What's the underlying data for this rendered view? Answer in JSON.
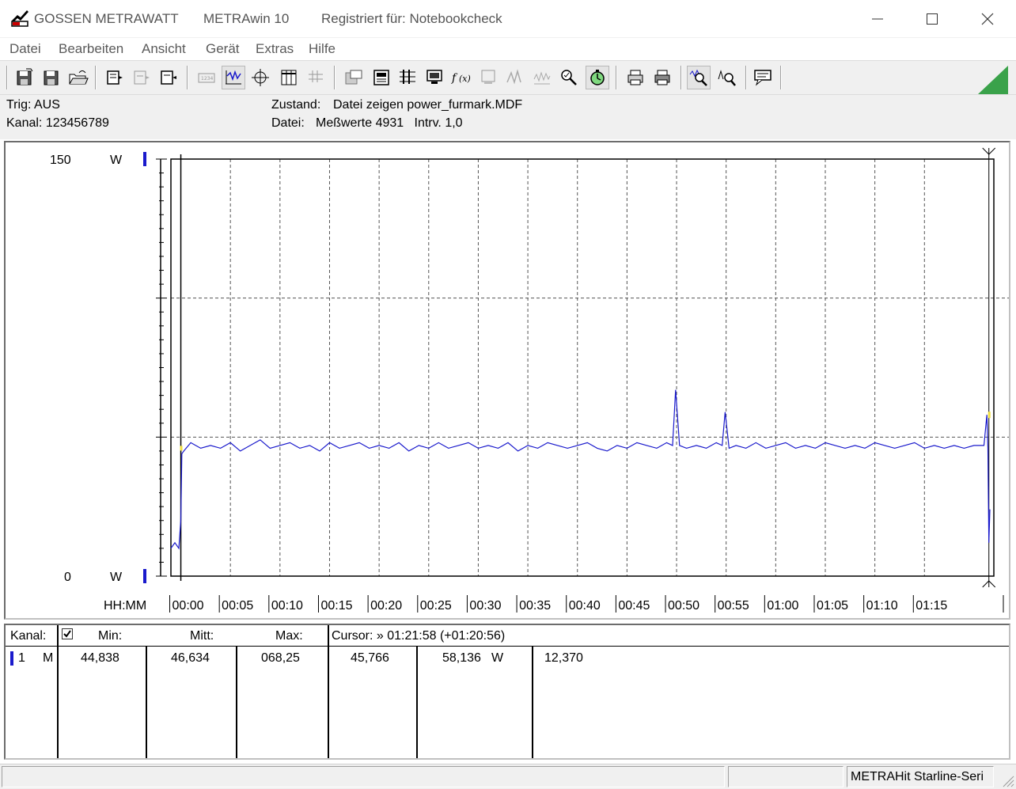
{
  "window": {
    "app_name": "GOSSEN METRAWATT",
    "version": "METRAwin 10",
    "registration": "Registriert für: Notebookcheck"
  },
  "menu": [
    "Datei",
    "Bearbeiten",
    "Ansicht",
    "Gerät",
    "Extras",
    "Hilfe"
  ],
  "toolbar": {
    "icons": [
      "save-icon",
      "save-as-icon",
      "open-icon",
      "export-icon",
      "disabled-export-icon",
      "import-icon",
      "memory-icon",
      "trace-view-icon",
      "crosshair-icon",
      "table-view-icon",
      "list-view-icon",
      "window-icon",
      "device-icon",
      "settings-icon",
      "monitor-icon",
      "function-icon",
      "device-disabled-icon",
      "signal-disabled-icon",
      "signal-disabled-2-icon",
      "zoom-check-icon",
      "timer-icon",
      "print-preview-icon",
      "print-icon",
      "zoom-icon",
      "zoom-out-icon",
      "comment-icon"
    ]
  },
  "info": {
    "trig": "Trig: AUS",
    "kanal": "Kanal: 123456789",
    "zustand_label": "Zustand:",
    "zustand_value": "Datei zeigen power_furmark.MDF",
    "datei_label": "Datei:",
    "datei_value": "Meßwerte 4931   Intrv. 1,0"
  },
  "chart_data": {
    "type": "line",
    "y_top_label": "150",
    "y_bottom_label": "0",
    "y_unit": "W",
    "ylim": [
      0,
      150
    ],
    "x_axis_label": "HH:MM",
    "x_ticks": [
      "00:00",
      "00:05",
      "00:10",
      "00:15",
      "00:20",
      "00:25",
      "00:30",
      "00:35",
      "00:40",
      "00:45",
      "00:50",
      "00:55",
      "01:00",
      "01:05",
      "01:10",
      "01:15"
    ],
    "x_range_minutes": [
      -1,
      82
    ],
    "grid": true,
    "series_color": "#1a1acc",
    "series": [
      {
        "name": "1",
        "x_minutes": [
          -1.0,
          -0.6,
          -0.2,
          0.0,
          0.1,
          0.3,
          1.0,
          2.0,
          3.0,
          4.0,
          5.0,
          6.0,
          7.0,
          8.0,
          9.0,
          10.0,
          11.0,
          12.0,
          13.0,
          14.0,
          15.0,
          16.0,
          17.0,
          18.0,
          19.0,
          20.0,
          21.0,
          22.0,
          23.0,
          24.0,
          25.0,
          26.0,
          27.0,
          28.0,
          29.0,
          30.0,
          31.0,
          32.0,
          33.0,
          34.0,
          35.0,
          36.0,
          37.0,
          38.0,
          39.0,
          40.0,
          41.0,
          42.0,
          43.0,
          44.0,
          45.0,
          46.0,
          47.0,
          48.0,
          49.0,
          49.6,
          49.9,
          50.3,
          51.0,
          52.0,
          53.0,
          54.0,
          54.6,
          54.9,
          55.3,
          56.0,
          57.0,
          58.0,
          59.0,
          60.0,
          61.0,
          62.0,
          63.0,
          64.0,
          65.0,
          66.0,
          67.0,
          68.0,
          69.0,
          70.0,
          71.0,
          72.0,
          73.0,
          74.0,
          75.0,
          76.0,
          77.0,
          78.0,
          79.0,
          80.0,
          81.0,
          81.3,
          81.4,
          81.5,
          81.6
        ],
        "y_watts": [
          10,
          12,
          10,
          20,
          44,
          45,
          48,
          46,
          47,
          46,
          48,
          45,
          47,
          49,
          46,
          47,
          48,
          46,
          47,
          45,
          48,
          46,
          47,
          48,
          46,
          47,
          46,
          48,
          45,
          47,
          46,
          48,
          46,
          47,
          48,
          46,
          47,
          46,
          48,
          45,
          47,
          46,
          48,
          47,
          46,
          47,
          48,
          46,
          45,
          47,
          46,
          48,
          47,
          46,
          48,
          47,
          67,
          47,
          46,
          47,
          46,
          48,
          47,
          59,
          46,
          47,
          46,
          48,
          46,
          47,
          48,
          46,
          47,
          46,
          48,
          47,
          46,
          47,
          46,
          48,
          47,
          46,
          47,
          48,
          46,
          47,
          46,
          47,
          46,
          47,
          47,
          58,
          46,
          12,
          24
        ]
      }
    ]
  },
  "table": {
    "kanal_header": "Kanal:",
    "min_header": "Min:",
    "mitt_header": "Mitt:",
    "max_header": "Max:",
    "cursor_header": "Cursor: » 01:21:58 (+01:20:56)",
    "row": {
      "channel": "1",
      "mode": "M",
      "min": "44,838",
      "mitt": "46,634",
      "max": "068,25",
      "cursor1": "45,766",
      "cursor2": "58,136",
      "unit": "W",
      "delta": "12,370"
    }
  },
  "status": {
    "panel3": "METRAHit Starline-Seri"
  }
}
